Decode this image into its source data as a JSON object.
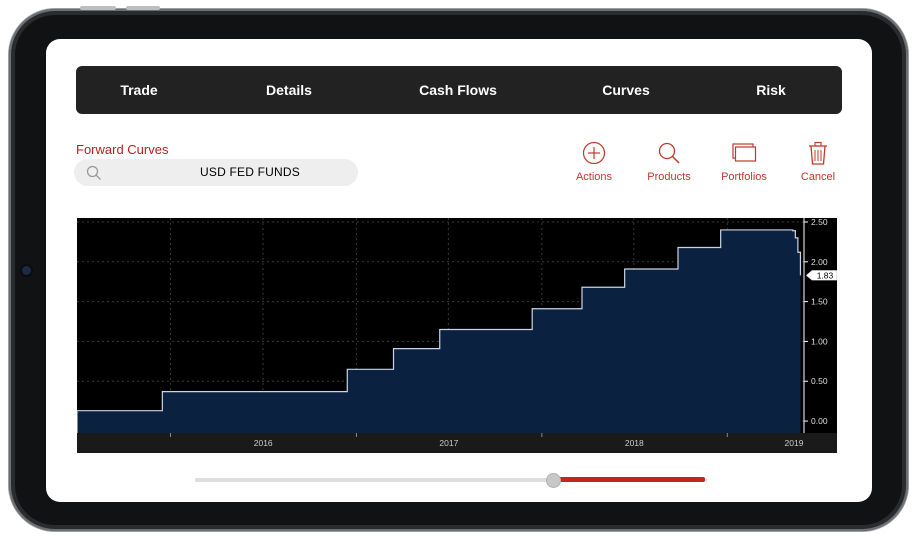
{
  "nav": {
    "tabs": [
      {
        "label": "Trade"
      },
      {
        "label": "Details"
      },
      {
        "label": "Cash Flows"
      },
      {
        "label": "Curves"
      },
      {
        "label": "Risk"
      }
    ]
  },
  "section": {
    "title": "Forward Curves"
  },
  "search": {
    "value": "USD FED FUNDS"
  },
  "actions": [
    {
      "label": "Actions",
      "icon": "plus-circle-icon"
    },
    {
      "label": "Products",
      "icon": "search-icon"
    },
    {
      "label": "Portfolios",
      "icon": "windows-icon"
    },
    {
      "label": "Cancel",
      "icon": "trash-icon"
    }
  ],
  "slider": {
    "value": 0.7
  },
  "colors": {
    "accent": "#c0392b",
    "chart_fill": "#0b2140",
    "chart_line": "#c9d4e6",
    "nav_bg": "#222222"
  },
  "chart_data": {
    "type": "area",
    "title": "",
    "xlabel": "",
    "ylabel": "",
    "x_ticks": [
      "2016",
      "2017",
      "2018",
      "2019"
    ],
    "xlim": [
      "2015-07-01",
      "2019-06-01"
    ],
    "y_ticks": [
      "2.50",
      "2.00",
      "1.50",
      "1.00",
      "0.50",
      "0.00"
    ],
    "ylim": [
      -0.15,
      2.55
    ],
    "last_value": "1.83",
    "grid": true,
    "series": [
      {
        "x": [
          "2015-07-01",
          "2015-12-16",
          "2016-12-14",
          "2017-03-15",
          "2017-06-14",
          "2017-12-13",
          "2018-03-21",
          "2018-06-13",
          "2018-09-26",
          "2018-12-19",
          "2019-05-10",
          "2019-05-15",
          "2019-05-20",
          "2019-05-25"
        ],
        "values": [
          0.13,
          0.37,
          0.65,
          0.91,
          1.15,
          1.41,
          1.68,
          1.91,
          2.18,
          2.4,
          2.39,
          2.3,
          2.12,
          1.83
        ]
      }
    ]
  }
}
